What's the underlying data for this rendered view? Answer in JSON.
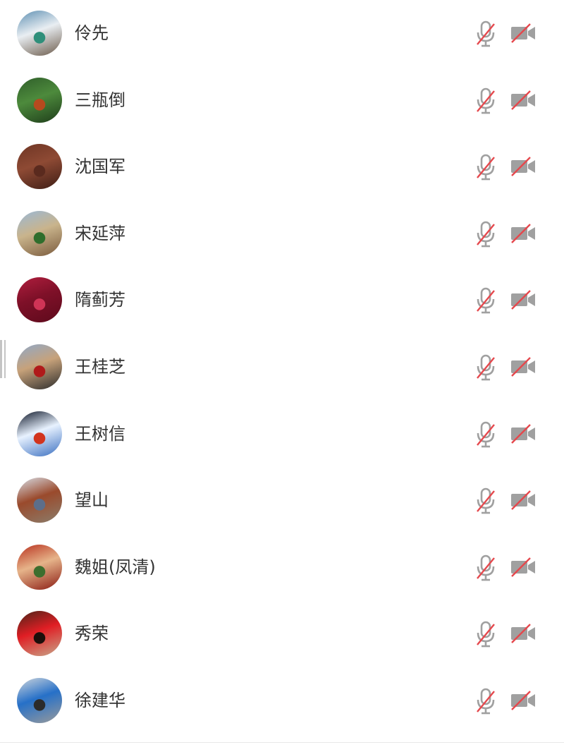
{
  "participants": [
    {
      "name": "伶先",
      "avatar": {
        "colors": [
          "#5d8fb2",
          "#e9eef2",
          "#2f8f7a",
          "#6b5a4a"
        ]
      },
      "mic_icon": "mic-muted-icon",
      "camera_icon": "camera-off-icon"
    },
    {
      "name": "三瓶倒",
      "avatar": {
        "colors": [
          "#2f5e2a",
          "#4d8a3c",
          "#b64a1e",
          "#1e3d1a"
        ]
      },
      "mic_icon": "mic-muted-icon",
      "camera_icon": "camera-off-icon"
    },
    {
      "name": "沈国军",
      "avatar": {
        "colors": [
          "#6e3524",
          "#8e4a34",
          "#5a2a1e",
          "#3e1d15"
        ]
      },
      "mic_icon": "mic-muted-icon",
      "camera_icon": "camera-off-icon"
    },
    {
      "name": "宋延萍",
      "avatar": {
        "colors": [
          "#9ab8d6",
          "#c9b48c",
          "#2f6e2c",
          "#7a5a3c"
        ]
      },
      "mic_icon": "mic-muted-icon",
      "camera_icon": "camera-off-icon"
    },
    {
      "name": "隋蓟芳",
      "avatar": {
        "colors": [
          "#b01e3e",
          "#7e1028",
          "#d03456",
          "#5e0a1c"
        ]
      },
      "mic_icon": "mic-muted-icon",
      "camera_icon": "camera-off-icon"
    },
    {
      "name": "王桂芝",
      "avatar": {
        "colors": [
          "#8fa8c8",
          "#c7a27a",
          "#b01a1a",
          "#2b2b2b"
        ]
      },
      "mic_icon": "mic-muted-icon",
      "camera_icon": "camera-off-icon"
    },
    {
      "name": "王树信",
      "avatar": {
        "colors": [
          "#0b1426",
          "#e8f2ff",
          "#d2341e",
          "#3a6fc0"
        ]
      },
      "mic_icon": "mic-muted-icon",
      "camera_icon": "camera-off-icon"
    },
    {
      "name": "望山",
      "avatar": {
        "colors": [
          "#d8dee6",
          "#9a4a2c",
          "#5c6e8a",
          "#8b7d6b"
        ]
      },
      "mic_icon": "mic-muted-icon",
      "camera_icon": "camera-off-icon"
    },
    {
      "name": "魏姐(凤清)",
      "avatar": {
        "colors": [
          "#b8301e",
          "#e6b48a",
          "#3d6e2e",
          "#8a1a12"
        ]
      },
      "mic_icon": "mic-muted-icon",
      "camera_icon": "camera-off-icon"
    },
    {
      "name": "秀荣",
      "avatar": {
        "colors": [
          "#4a2418",
          "#e01e24",
          "#1c0e0a",
          "#c7a78a"
        ]
      },
      "mic_icon": "mic-muted-icon",
      "camera_icon": "camera-off-icon"
    },
    {
      "name": "徐建华",
      "avatar": {
        "colors": [
          "#cfd6dc",
          "#2670c8",
          "#2b2b2b",
          "#9a9a9a"
        ]
      },
      "mic_icon": "mic-muted-icon",
      "camera_icon": "camera-off-icon"
    }
  ],
  "icon_colors": {
    "device": "#a0a0a0",
    "slash": "#e5484d"
  }
}
